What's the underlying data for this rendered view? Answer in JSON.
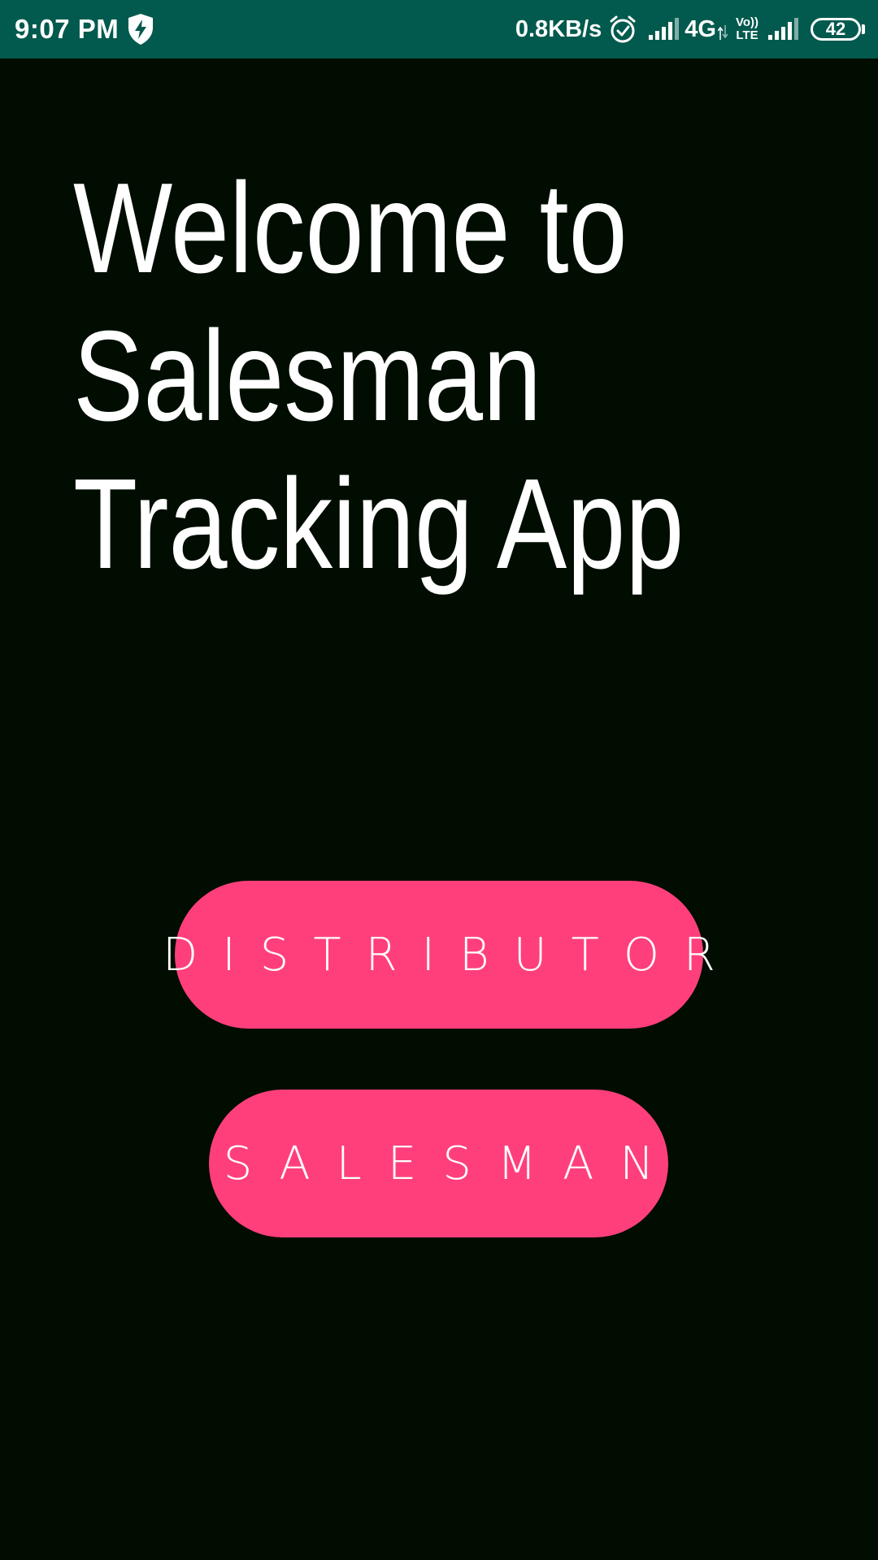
{
  "status_bar": {
    "time": "9:07 PM",
    "net_speed": "0.8KB/s",
    "network_type": "4G",
    "volte_top": "Vo))",
    "volte_bottom": "LTE",
    "battery": "42",
    "icons": [
      "shield-lightning-icon",
      "alarm-icon",
      "signal-icon",
      "data-arrows-icon",
      "signal-icon",
      "battery-icon"
    ],
    "background_color": "#025a4e"
  },
  "main": {
    "title": "Welcome to\nSalesman\nTracking App",
    "background_color": "#000d00",
    "buttons": {
      "distributor": "DISTRIBUTOR",
      "salesman": "SALESMAN"
    },
    "button_color": "#ff3f7c"
  }
}
